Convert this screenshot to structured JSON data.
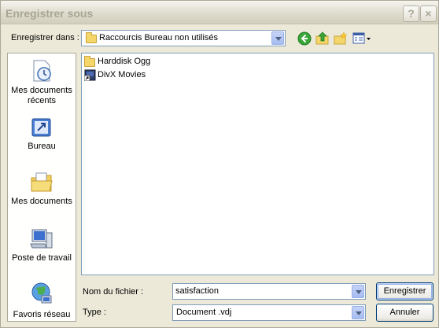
{
  "window": {
    "title": "Enregistrer sous",
    "help_glyph": "?",
    "close_glyph": "×"
  },
  "look_in": {
    "label": "Enregistrer dans :",
    "value": "Raccourcis Bureau non utilisés"
  },
  "toolbar": {
    "icons": [
      "back-icon",
      "up-folder-icon",
      "new-folder-icon",
      "view-menu-icon"
    ]
  },
  "places": [
    {
      "label": "Mes documents récents",
      "icon": "recent-documents-icon"
    },
    {
      "label": "Bureau",
      "icon": "desktop-icon"
    },
    {
      "label": "Mes documents",
      "icon": "my-documents-icon"
    },
    {
      "label": "Poste de travail",
      "icon": "my-computer-icon"
    },
    {
      "label": "Favoris réseau",
      "icon": "network-places-icon"
    }
  ],
  "files": [
    {
      "name": "Harddisk Ogg",
      "icon": "folder-icon"
    },
    {
      "name": "DivX Movies",
      "icon": "shortcut-icon"
    }
  ],
  "filename": {
    "label": "Nom du fichier :",
    "value": "satisfaction"
  },
  "filetype": {
    "label": "Type :",
    "value": "Document .vdj"
  },
  "buttons": {
    "save": "Enregistrer",
    "cancel": "Annuler"
  },
  "colors": {
    "accent": "#316ac5",
    "dialog_bg": "#ece9d8",
    "title_text": "#a8a692"
  }
}
